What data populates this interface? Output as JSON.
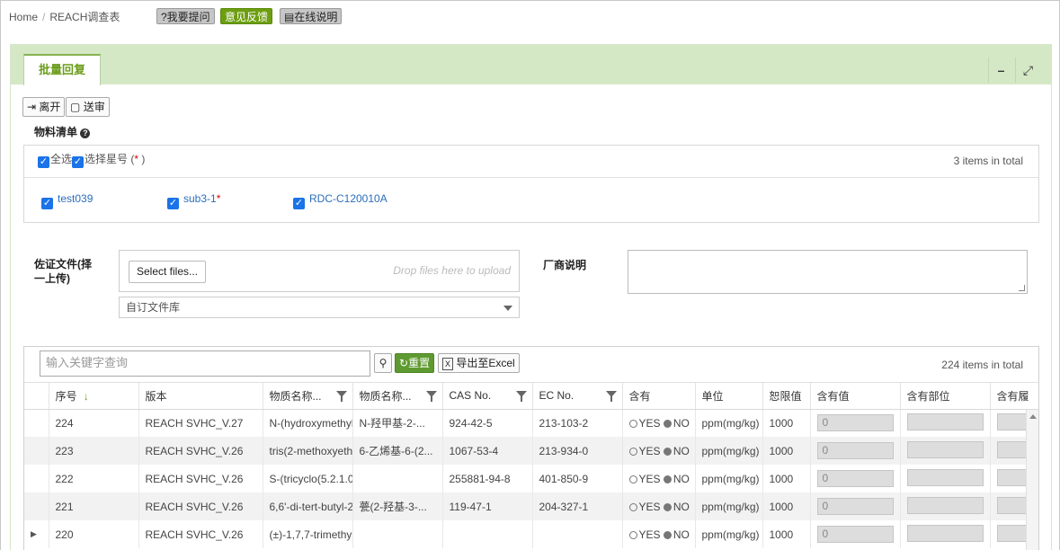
{
  "breadcrumb": {
    "home": "Home",
    "sep": "/",
    "current": "REACH调查表"
  },
  "header_buttons": {
    "ask": "?我要提问",
    "feedback": "意见反馈",
    "manual": "在线说明"
  },
  "tab": {
    "label": "批量回复"
  },
  "window_controls": {
    "minimize": "–",
    "maximize": "⤢"
  },
  "toolbar": {
    "leave": "离开",
    "submit": "送审"
  },
  "materials": {
    "title": "物料清单",
    "select_all": "全选",
    "select_star": "选择星号",
    "star_paren_open": "(",
    "star": "*",
    "star_paren_close": ")",
    "count": "3 items in total",
    "items": [
      {
        "label": "test039",
        "star": ""
      },
      {
        "label": "sub3-1",
        "star": "*"
      },
      {
        "label": "RDC-C120010A",
        "star": ""
      }
    ]
  },
  "upload": {
    "label_line1": "佐证文件(择",
    "label_line2": "一上传)",
    "select_files": "Select files...",
    "drop_hint": "Drop files here to upload",
    "library_select": "自订文件库"
  },
  "vendor": {
    "label": "厂商说明"
  },
  "grid": {
    "search_placeholder": "输入关键字查询",
    "reset": "重置",
    "export": "导出至Excel",
    "count": "224 items in total",
    "columns": [
      "序号",
      "版本",
      "物质名称...",
      "物质名称...",
      "CAS No.",
      "EC No.",
      "含有",
      "单位",
      "恕限值",
      "含有值",
      "含有部位",
      "含有履"
    ],
    "yes": "YES",
    "no": "NO",
    "rows": [
      {
        "no": "224",
        "version": "REACH SVHC_V.27",
        "name_en": "N-(hydroxymethyl)",
        "name_cn": "N-羟甲基-2-...",
        "cas": "924-42-5",
        "ec": "213-103-2",
        "unit": "ppm(mg/kg)",
        "limit": "1000",
        "value": "0"
      },
      {
        "no": "223",
        "version": "REACH SVHC_V.26",
        "name_en": "tris(2-methoxyeth",
        "name_cn": "6-乙烯基-6-(2...",
        "cas": "1067-53-4",
        "ec": "213-934-0",
        "unit": "ppm(mg/kg)",
        "limit": "1000",
        "value": "0"
      },
      {
        "no": "222",
        "version": "REACH SVHC_V.26",
        "name_en": "S-(tricyclo(5.2.1.0",
        "name_cn": "",
        "cas": "255881-94-8",
        "ec": "401-850-9",
        "unit": "ppm(mg/kg)",
        "limit": "1000",
        "value": "0"
      },
      {
        "no": "221",
        "version": "REACH SVHC_V.26",
        "name_en": "6,6'-di-tert-butyl-2",
        "name_cn": "甍(2-羟基-3-...",
        "cas": "119-47-1",
        "ec": "204-327-1",
        "unit": "ppm(mg/kg)",
        "limit": "1000",
        "value": "0"
      },
      {
        "no": "220",
        "version": "REACH SVHC_V.26",
        "name_en": "(±)-1,7,7-trimethy",
        "name_cn": "",
        "cas": "",
        "ec": "",
        "unit": "ppm(mg/kg)",
        "limit": "1000",
        "value": "0"
      }
    ]
  },
  "colors": {
    "accent_green": "#6c9e10",
    "panel_header": "#d5e8c6",
    "checkbox_blue": "#1a73e8",
    "link_blue": "#2a6ebb"
  }
}
